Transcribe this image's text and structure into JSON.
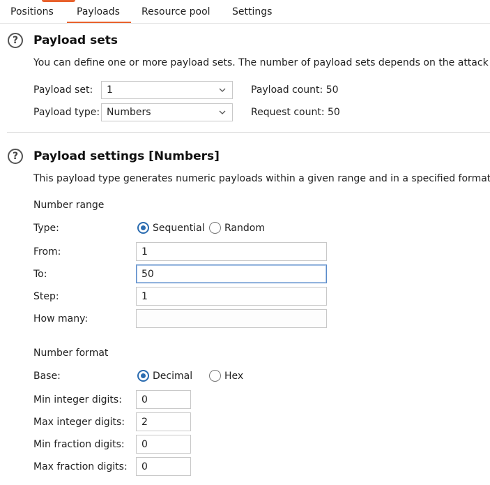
{
  "tabs": [
    {
      "label": "Positions"
    },
    {
      "label": "Payloads",
      "active": true
    },
    {
      "label": "Resource pool"
    },
    {
      "label": "Settings"
    }
  ],
  "payload_sets": {
    "title": "Payload sets",
    "description": "You can define one or more payload sets. The number of payload sets depends on the attack t",
    "set_label": "Payload set:",
    "set_value": "1",
    "type_label": "Payload type:",
    "type_value": "Numbers",
    "payload_count": "Payload count: 50",
    "request_count": "Request count: 50"
  },
  "payload_settings": {
    "title": "Payload settings [Numbers]",
    "description": "This payload type generates numeric payloads within a given range and in a specified format.",
    "number_range": {
      "heading": "Number range",
      "type_label": "Type:",
      "sequential_label": "Sequential",
      "random_label": "Random",
      "selected": "Sequential",
      "from_label": "From:",
      "from_value": "1",
      "to_label": "To:",
      "to_value": "50",
      "step_label": "Step:",
      "step_value": "1",
      "how_many_label": "How many:",
      "how_many_value": ""
    },
    "number_format": {
      "heading": "Number format",
      "base_label": "Base:",
      "decimal_label": "Decimal",
      "hex_label": "Hex",
      "selected": "Decimal",
      "min_int_label": "Min integer digits:",
      "min_int_value": "0",
      "max_int_label": "Max integer digits:",
      "max_int_value": "2",
      "min_frac_label": "Min fraction digits:",
      "min_frac_value": "0",
      "max_frac_label": "Max fraction digits:",
      "max_frac_value": "0"
    }
  },
  "icons": {
    "help": "help-icon",
    "dropdown": "chevron-down-icon"
  },
  "colors": {
    "accent": "#e8612c",
    "radio": "#2b6cb0",
    "focus": "#5b8bc9"
  }
}
